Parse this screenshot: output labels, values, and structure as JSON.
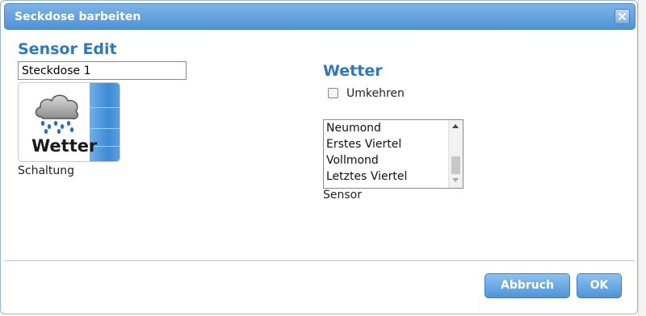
{
  "dialog": {
    "title": "Seckdose barbeiten",
    "close_icon": "close-icon"
  },
  "sensor_edit": {
    "heading": "Sensor Edit",
    "name_value": "Steckdose 1",
    "icon": {
      "name": "rain-cloud-icon",
      "caption": "Wetter"
    },
    "schaltung_label": "Schaltung"
  },
  "weather": {
    "heading": "Wetter",
    "invert_label": "Umkehren",
    "invert_checked": false,
    "moon_phases": [
      "Neumond",
      "Erstes Viertel",
      "Vollmond",
      "Letztes Viertel"
    ],
    "sensor_label": "Sensor"
  },
  "footer": {
    "cancel_label": "Abbruch",
    "ok_label": "OK"
  },
  "colors": {
    "accent": "#2d79c0",
    "titlebar": "#5b9bd9",
    "button": "#5a9ddd"
  }
}
